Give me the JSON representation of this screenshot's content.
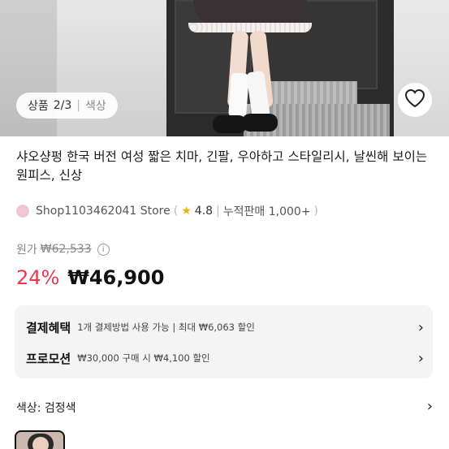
{
  "hero": {
    "page_label": "상품",
    "page_counter": "2/3",
    "color_label": "색상"
  },
  "product": {
    "title": "샤오샹펑 한국 버전 여성 짧은 치마, 긴팔, 우아하고 스타일리시, 날씬해 보이는 원피스, 신상",
    "store_name": "Shop1103462041 Store",
    "rating": "4.8",
    "sales": "누적판매 1,000+",
    "original_label": "원가",
    "original_price": "₩62,533",
    "discount": "24%",
    "price": "₩46,900"
  },
  "benefits": {
    "payment_label": "결제혜택",
    "payment_desc": "1개 결제방법 사용 가능 | 최대 ₩6,063 할인",
    "promo_label": "프로모션",
    "promo_desc": "₩30,000 구매 시 ₩4,100 할인"
  },
  "options": {
    "color_row": "색상: 검정색"
  },
  "icons": {
    "heart": "heart-icon",
    "chevron": "chevron-right-icon",
    "star": "star-icon",
    "info": "info-icon"
  },
  "colors": {
    "discount": "#e8384f",
    "star": "#f0b400",
    "benefit_bg": "#f4f4f4"
  }
}
